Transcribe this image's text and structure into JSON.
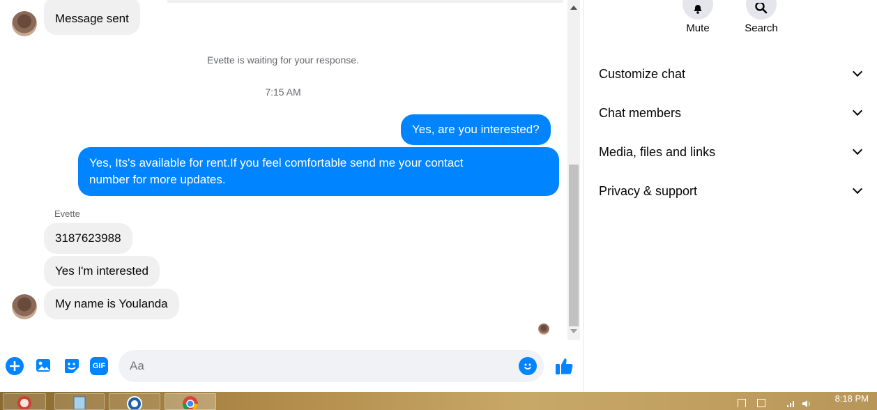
{
  "chat": {
    "messages": {
      "sent_status": "Message sent",
      "waiting": "Evette is waiting for your response.",
      "time": "7:15 AM",
      "out1": "Yes, are you interested?",
      "out2_line1": "Yes, Its's available for rent.If you feel comfortable send me your contact",
      "out2_line2": "number for more updates.",
      "sender": "Evette",
      "in1": "3187623988",
      "in2": "Yes I'm interested",
      "in3": "My name is Youlanda"
    },
    "composer": {
      "placeholder": "Aa",
      "icons": [
        "plus-icon",
        "image-icon",
        "sticker-icon",
        "gif-icon",
        "emoji-icon",
        "like-icon"
      ],
      "gif_label": "GIF"
    }
  },
  "panel": {
    "actions": [
      {
        "label": "Mute",
        "icon": "bell-icon"
      },
      {
        "label": "Search",
        "icon": "search-icon"
      }
    ],
    "sections": [
      {
        "label": "Customize chat"
      },
      {
        "label": "Chat members"
      },
      {
        "label": "Media, files and links"
      },
      {
        "label": "Privacy & support"
      }
    ]
  },
  "taskbar": {
    "clock": "8:18 PM",
    "apps": [
      "start-orb",
      "notepad-icon",
      "safari-icon",
      "chrome-icon"
    ]
  },
  "colors": {
    "accent": "#0084ff",
    "incoming": "#f0f0f0"
  }
}
